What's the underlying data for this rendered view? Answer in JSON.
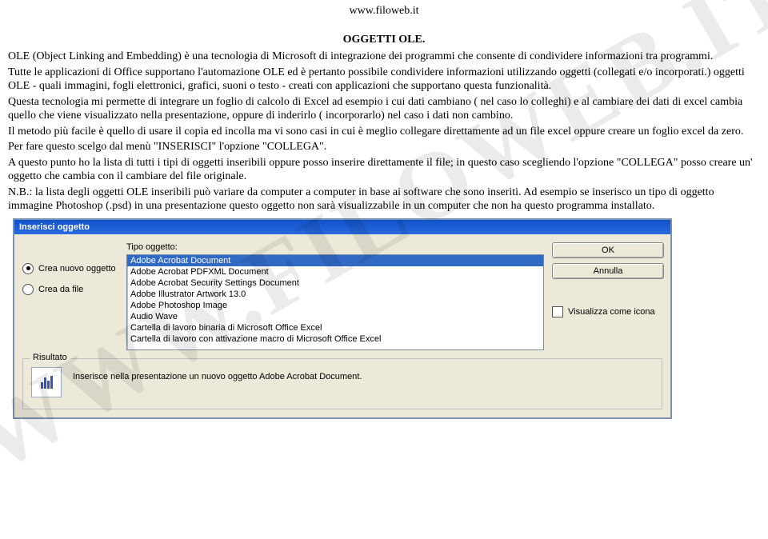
{
  "site_url": "www.filoweb.it",
  "watermark": "WWW.FILOWEB.IT",
  "heading": "OGGETTI OLE.",
  "paragraphs": [
    "OLE  (Object Linking and Embedding) è una tecnologia di Microsoft di integrazione dei programmi che consente di condividere informazioni tra programmi.",
    "Tutte le applicazioni di Office supportano l'automazione OLE ed è pertanto possibile condividere informazioni utilizzando oggetti (collegati e/o incorporati.) oggetti OLE - quali immagini, fogli elettronici, grafici, suoni o testo - creati con applicazioni che supportano questa funzionalità.",
    "Questa tecnologia mi permette di integrare un foglio di calcolo di Excel ad esempio i cui dati cambiano ( nel caso lo colleghi)  e al cambiare dei dati di excel cambia quello che viene visualizzato nella presentazione, oppure di inderirlo ( incorporarlo) nel caso i dati non cambino.",
    "Il metodo più facile è quello di usare il copia ed incolla ma vi sono casi in cui è meglio collegare direttamente ad un file excel oppure creare un foglio excel da zero.",
    "Per fare questo scelgo dal menù \"INSERISCI\" l'opzione \"COLLEGA\".",
    "A questo punto ho la lista di tutti i tipi di oggetti inseribili oppure posso inserire direttamente il file; in questo caso scegliendo l'opzione \"COLLEGA\" posso creare un' oggetto che cambia con il cambiare del file originale.",
    "N.B.: la lista degli oggetti OLE inseribili può variare da computer a computer in base ai software che sono inseriti. Ad esempio se inserisco un tipo di oggetto immagine Photoshop (.psd) in una presentazione questo oggetto non sarà visualizzabile in un computer che non ha questo programma installato."
  ],
  "dialog": {
    "title": "Inserisci oggetto",
    "radio_new": "Crea nuovo oggetto",
    "radio_file": "Crea da file",
    "type_label": "Tipo oggetto:",
    "items": [
      "Adobe Acrobat Document",
      "Adobe Acrobat PDFXML Document",
      "Adobe Acrobat Security Settings Document",
      "Adobe Illustrator Artwork 13.0",
      "Adobe Photoshop Image",
      "Audio Wave",
      "Cartella di lavoro binaria di Microsoft Office Excel",
      "Cartella di lavoro con attivazione macro di Microsoft Office Excel"
    ],
    "ok": "OK",
    "cancel": "Annulla",
    "show_as_icon": "Visualizza come icona",
    "result_label": "Risultato",
    "result_text": "Inserisce nella presentazione un nuovo oggetto Adobe Acrobat Document."
  }
}
